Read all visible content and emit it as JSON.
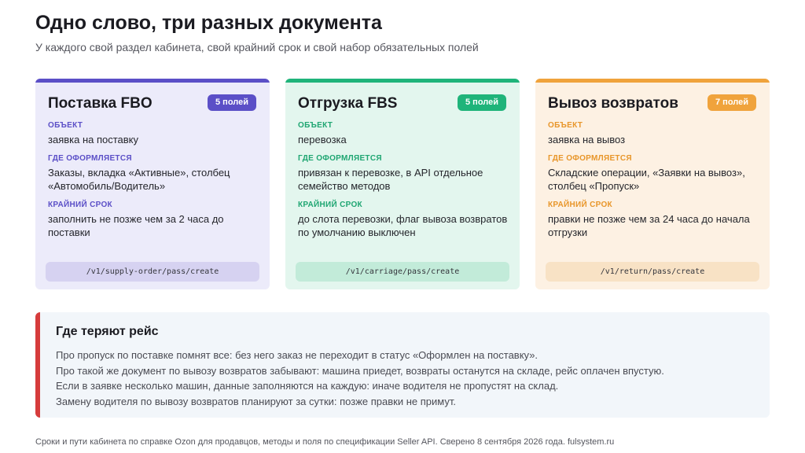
{
  "header": {
    "title": "Одно слово, три разных документа",
    "subtitle": "У каждого свой раздел кабинета, свой крайний срок и свой набор обязательных полей"
  },
  "cards": [
    {
      "title": "Поставка FBO",
      "badge": "5 полей",
      "accent": "#5b4fc7",
      "label_color": "#5b4fc7",
      "bg": "#ecebfa",
      "path_bg": "#d6d2f1",
      "sections": [
        {
          "label": "ОБЪЕКТ",
          "text": "заявка на поставку"
        },
        {
          "label": "ГДЕ ОФОРМЛЯЕТСЯ",
          "text": "Заказы, вкладка «Активные», столбец «Автомобиль/Водитель»"
        },
        {
          "label": "КРАЙНИЙ СРОК",
          "text": "заполнить не позже чем за 2 часа до поставки"
        }
      ],
      "path": "/v1/supply-order/pass/create"
    },
    {
      "title": "Отгрузка FBS",
      "badge": "5 полей",
      "accent": "#1fb47a",
      "label_color": "#1fa672",
      "bg": "#e3f6ee",
      "path_bg": "#c2ebd9",
      "sections": [
        {
          "label": "ОБЪЕКТ",
          "text": "перевозка"
        },
        {
          "label": "ГДЕ ОФОРМЛЯЕТСЯ",
          "text": "привязан к перевозке, в API отдельное семейство методов"
        },
        {
          "label": "КРАЙНИЙ СРОК",
          "text": "до слота перевозки, флаг вывоза возвратов по умолчанию выключен"
        }
      ],
      "path": "/v1/carriage/pass/create"
    },
    {
      "title": "Вывоз возвратов",
      "badge": "7 полей",
      "accent": "#f0a33c",
      "label_color": "#e8962a",
      "bg": "#fdf1e3",
      "path_bg": "#f8e2c5",
      "sections": [
        {
          "label": "ОБЪЕКТ",
          "text": "заявка на вывоз"
        },
        {
          "label": "ГДЕ ОФОРМЛЯЕТСЯ",
          "text": "Складские операции, «Заявки на вывоз», столбец «Пропуск»"
        },
        {
          "label": "КРАЙНИЙ СРОК",
          "text": "правки не позже чем за 24 часа до начала отгрузки"
        }
      ],
      "path": "/v1/return/pass/create"
    }
  ],
  "callout": {
    "title": "Где теряют рейс",
    "accent": "#d63c3c",
    "lines": [
      "Про пропуск по поставке помнят все: без него заказ не переходит в статус «Оформлен на поставку».",
      "Про такой же документ по вывозу возвратов забывают: машина приедет, возвраты останутся на складе, рейс оплачен впустую.",
      "Если в заявке несколько машин, данные заполняются на каждую: иначе водителя не пропустят на склад.",
      "Замену водителя по вывозу возвратов планируют за сутки: позже правки не примут."
    ]
  },
  "footer": {
    "text": "Сроки и пути кабинета по справке Ozon для продавцов, методы и поля по спецификации Seller API. Сверено 8 сентября 2026 года. fulsystem.ru"
  }
}
